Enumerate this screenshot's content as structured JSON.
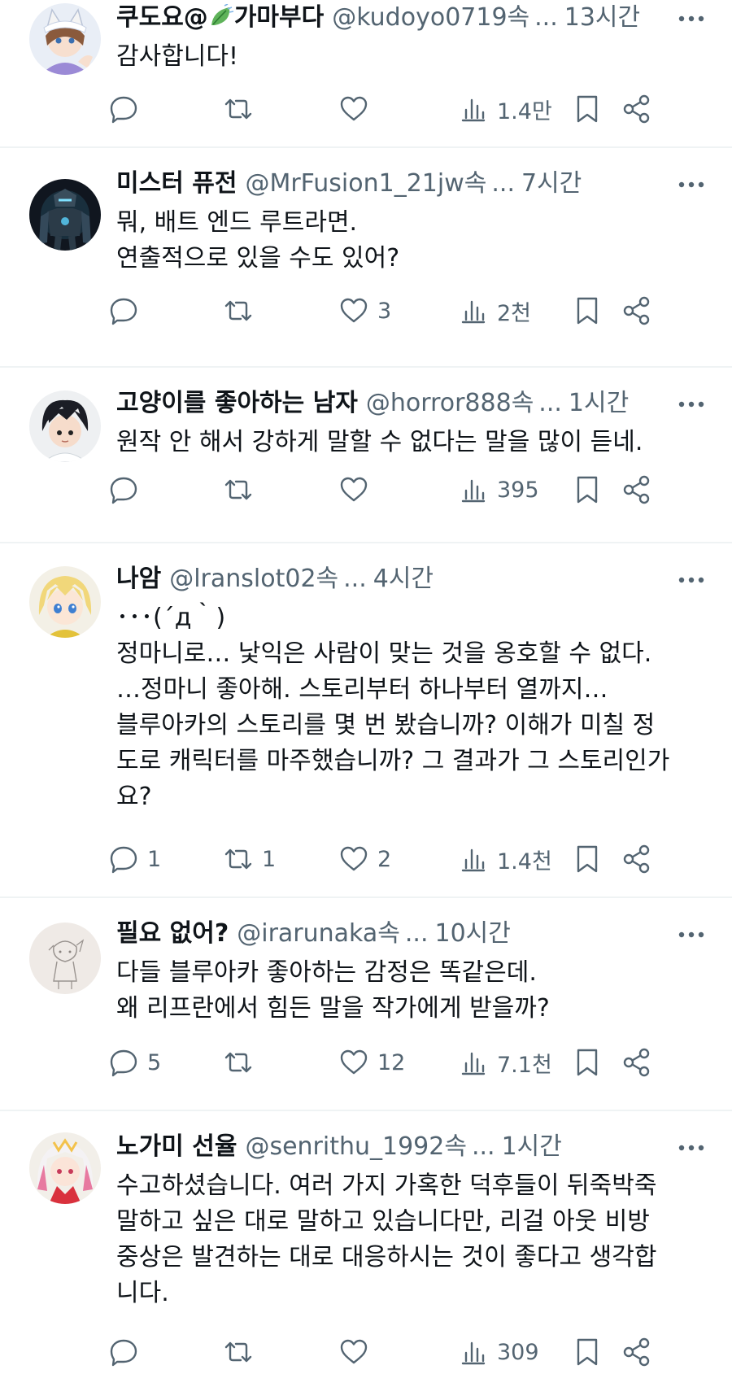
{
  "colors": {
    "text_primary": "#0f1419",
    "text_secondary": "#536471",
    "divider": "#eff3f4",
    "background": "#ffffff"
  },
  "icons": {
    "reply": "speech-bubble-icon",
    "retweet": "retweet-icon",
    "like": "heart-icon",
    "views": "bar-chart-icon",
    "bookmark": "bookmark-icon",
    "share": "share-icon",
    "more": "more-dots-icon"
  },
  "tweets": [
    {
      "name_prefix": "쿠도요@",
      "name_suffix": "가마부다",
      "handle": "@kudoyo0719속",
      "ellipsis": "...",
      "time": "13시간",
      "text": "감사합니다!",
      "replies": "",
      "retweets": "",
      "likes": "",
      "views": "1.4만"
    },
    {
      "name": "미스터 퓨전",
      "handle": "@MrFusion1_21jw속",
      "ellipsis": "...",
      "time": "7시간",
      "text": "뭐, 배트 엔드 루트라면.\n연출적으로 있을 수도 있어?",
      "replies": "",
      "retweets": "",
      "likes": "3",
      "views": "2천"
    },
    {
      "name": "고양이를 좋아하는 남자",
      "handle": "@horror888속",
      "ellipsis": "...",
      "time": "1시간",
      "text": "원작 안 해서 강하게 말할 수 없다는 말을 많이 듣네.",
      "replies": "",
      "retweets": "",
      "likes": "",
      "views": "395"
    },
    {
      "name": "나암",
      "handle": "@lranslot02속",
      "ellipsis": "...",
      "time": "4시간",
      "text": "･･･(´д｀)\n정마니로… 낯익은 사람이 맞는 것을 옹호할 수 없다.\n…정마니 좋아해. 스토리부터 하나부터 열까지…\n블루아카의 스토리를 몇 번 봤습니까? 이해가 미칠 정\n도로 캐릭터를 마주했습니까? 그 결과가 그 스토리인가\n요?",
      "replies": "1",
      "retweets": "1",
      "likes": "2",
      "views": "1.4천"
    },
    {
      "name": "필요 없어?",
      "handle": "@irarunaka속",
      "ellipsis": "...",
      "time": "10시간",
      "text": "다들 블루아카 좋아하는 감정은 똑같은데.\n왜 리프란에서 힘든 말을 작가에게 받을까?",
      "replies": "5",
      "retweets": "",
      "likes": "12",
      "views": "7.1천"
    },
    {
      "name": "노가미 선율",
      "handle": "@senrithu_1992속",
      "ellipsis": "...",
      "time": "1시간",
      "text": "수고하셨습니다. 여러 가지 가혹한 덕후들이 뒤죽박죽\n말하고 싶은 대로 말하고 있습니다만, 리걸 아웃 비방\n중상은 발견하는 대로 대응하시는 것이 좋다고 생각합\n니다.",
      "replies": "",
      "retweets": "",
      "likes": "",
      "views": "309"
    }
  ]
}
